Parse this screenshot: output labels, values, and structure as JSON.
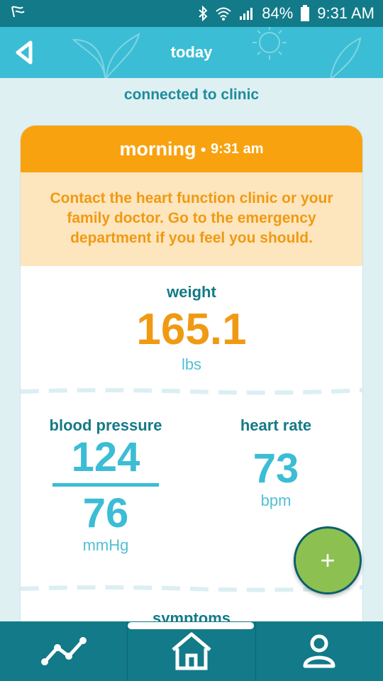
{
  "status": {
    "battery": "84%",
    "time": "9:31 AM"
  },
  "header": {
    "title": "today"
  },
  "connection": {
    "text": "connected to clinic"
  },
  "entry": {
    "period": "morning",
    "time": "9:31 am",
    "alert": "Contact the heart function clinic or your family doctor. Go to the emergency department if you feel you should."
  },
  "weight": {
    "label": "weight",
    "value": "165.1",
    "unit": "lbs"
  },
  "blood_pressure": {
    "label": "blood pressure",
    "systolic": "124",
    "diastolic": "76",
    "unit": "mmHg"
  },
  "heart_rate": {
    "label": "heart rate",
    "value": "73",
    "unit": "bpm"
  },
  "symptoms": {
    "label": "symptoms"
  },
  "fab": {
    "symbol": "+"
  },
  "colors": {
    "status_bar": "#127a88",
    "header": "#3bbdd5",
    "accent_orange": "#f8a20f",
    "alert_bg": "#fde5bd",
    "fab_green": "#8cc152"
  }
}
